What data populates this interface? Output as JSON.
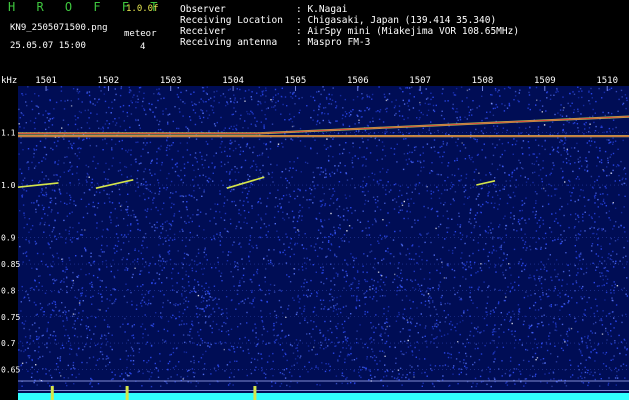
{
  "header": {
    "app_title": "H R O F F T",
    "version": "1.0.0f",
    "file_name": "KN9_2505071500.png",
    "date_time": "25.05.07 15:00",
    "meteor_label": "meteor",
    "meteor_count": "4",
    "info": [
      {
        "label": "Observer",
        "value": ": K.Nagai"
      },
      {
        "label": "Receiving Location",
        "value": ": Chigasaki, Japan (139.414 35.340)"
      },
      {
        "label": "Receiver",
        "value": ": AirSpy mini (Miakejima VOR 108.65MHz)"
      },
      {
        "label": "Receiving antenna",
        "value": ": Maspro FM-3"
      }
    ]
  },
  "chart_data": {
    "type": "heatmap",
    "ylabel": "kHz",
    "x_ticks": [
      "1501",
      "1502",
      "1503",
      "1504",
      "1505",
      "1506",
      "1507",
      "1508",
      "1509",
      "1510"
    ],
    "x": [
      1501,
      1502,
      1503,
      1504,
      1505,
      1506,
      1507,
      1508,
      1509,
      1510
    ],
    "xlim": [
      1500.55,
      1510.35
    ],
    "y_ticks": [
      "1.1",
      "1.0",
      "0.9",
      "0.85",
      "0.8",
      "0.75",
      "0.7",
      "0.65"
    ],
    "y": [
      1.1,
      1.0,
      0.9,
      0.85,
      0.8,
      0.75,
      0.7,
      0.65
    ],
    "ylim": [
      0.592,
      1.188
    ],
    "grid": true,
    "colors": {
      "background": "#000d55",
      "noise": "#2f4fff",
      "strong": "#ffffff",
      "carrier": "#e83a3a",
      "echo": "#d6e64a",
      "power": "#31ffff"
    },
    "traces": [
      {
        "type": "carrier",
        "points": [
          [
            1500.55,
            1.098
          ],
          [
            1504.4,
            1.098
          ],
          [
            1510.35,
            1.13
          ]
        ]
      },
      {
        "type": "carrier",
        "points": [
          [
            1500.55,
            1.093
          ],
          [
            1510.35,
            1.093
          ]
        ]
      },
      {
        "type": "echo",
        "points": [
          [
            1500.55,
            0.996
          ],
          [
            1501.2,
            1.004
          ]
        ]
      },
      {
        "type": "echo",
        "points": [
          [
            1501.8,
            0.994
          ],
          [
            1502.4,
            1.01
          ]
        ]
      },
      {
        "type": "echo",
        "points": [
          [
            1503.9,
            0.994
          ],
          [
            1504.5,
            1.015
          ]
        ]
      },
      {
        "type": "echo",
        "points": [
          [
            1507.9,
            1.0
          ],
          [
            1508.2,
            1.008
          ]
        ]
      }
    ],
    "bursts": [
      1501.1,
      1502.3,
      1504.35
    ]
  }
}
